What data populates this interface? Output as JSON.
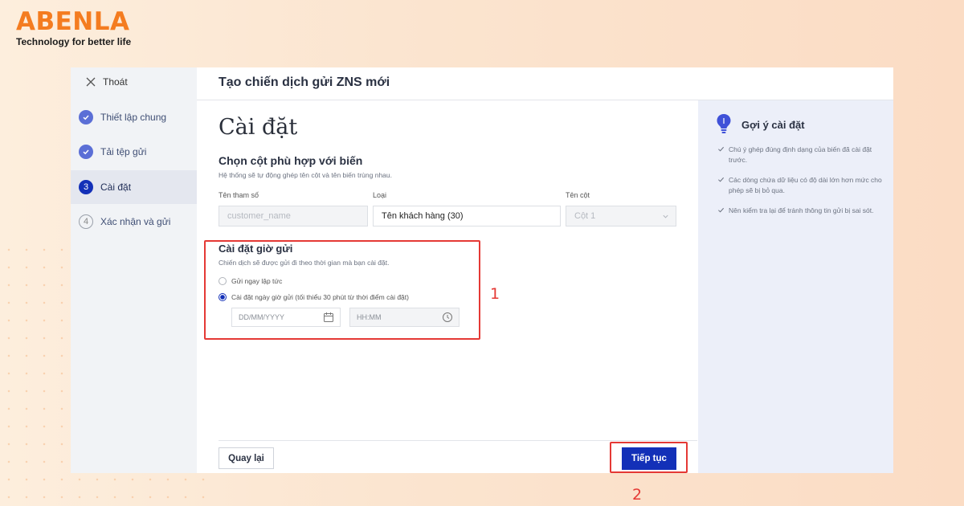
{
  "brand": {
    "name": "ABENLA",
    "tagline": "Technology for better life"
  },
  "sidebar": {
    "exit_label": "Thoát",
    "steps": [
      {
        "label": "Thiết lập chung",
        "state": "done",
        "number": "1"
      },
      {
        "label": "Tải tệp gửi",
        "state": "done",
        "number": "2"
      },
      {
        "label": "Cài đặt",
        "state": "current",
        "number": "3"
      },
      {
        "label": "Xác nhận và gửi",
        "state": "todo",
        "number": "4"
      }
    ]
  },
  "header": {
    "title": "Tạo chiến dịch gửi ZNS mới"
  },
  "main": {
    "heading": "Cài đặt",
    "mapping": {
      "title": "Chọn cột phù hợp với biến",
      "description": "Hệ thống sẽ tự động ghép tên cột và tên biến trùng nhau.",
      "col_param": "Tên tham số",
      "col_type": "Loại",
      "col_column": "Tên cột",
      "param_value": "customer_name",
      "type_value": "Tên khách hàng (30)",
      "column_value": "Cột 1"
    },
    "schedule": {
      "title": "Cài đặt giờ gửi",
      "description": "Chiến dịch sẽ được gửi đi theo thời gian mà bạn cài đặt.",
      "option_now": "Gửi ngay lập tức",
      "option_scheduled": "Cài đặt ngày giờ gửi (tối thiểu 30 phút từ thời điểm cài đặt)",
      "selected": "scheduled",
      "date_placeholder": "DD/MM/YYYY",
      "time_placeholder": "HH:MM"
    },
    "annotation_1": "1",
    "annotation_2": "2",
    "back_button": "Quay lại",
    "next_button": "Tiếp tục"
  },
  "tips": {
    "title": "Gợi ý cài đặt",
    "items": [
      "Chú ý ghép đúng định dạng của biến đã cài đặt trước.",
      "Các dòng chứa dữ liệu có độ dài lớn hơn mức cho phép sẽ bị bỏ qua.",
      "Nên kiểm tra lại để tránh thông tin gửi bị sai sót."
    ]
  },
  "colors": {
    "primary": "#1330b8",
    "brand_orange": "#f47c20",
    "annotation_red": "#e53935"
  }
}
